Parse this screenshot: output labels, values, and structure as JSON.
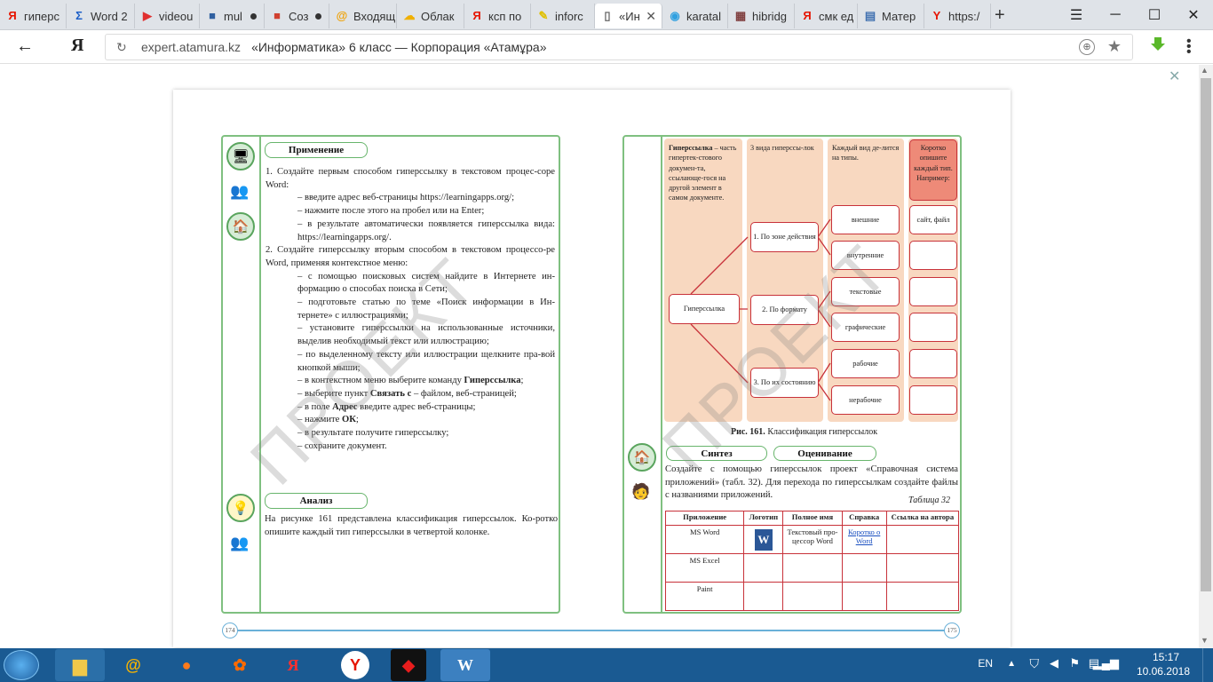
{
  "tabs": [
    {
      "label": "гиперс",
      "icon": "yandex-icon",
      "icon_color": "#e61400"
    },
    {
      "label": "Word 2",
      "icon": "sigma-icon",
      "icon_color": "#1e60c8"
    },
    {
      "label": "videou",
      "icon": "play-icon",
      "icon_color": "#e03030"
    },
    {
      "label": "mul",
      "icon": "cube-icon",
      "icon_color": "#3060a0",
      "modified": true
    },
    {
      "label": "Соз",
      "icon": "briefcase-icon",
      "icon_color": "#d04030",
      "modified": true
    },
    {
      "label": "Входящ",
      "icon": "mail-icon",
      "icon_color": "#f0a000"
    },
    {
      "label": "Облак",
      "icon": "cloud-icon",
      "icon_color": "#f0b000"
    },
    {
      "label": "ксп по",
      "icon": "yandex-icon",
      "icon_color": "#e61400"
    },
    {
      "label": "inforc",
      "icon": "pencil-icon",
      "icon_color": "#e0c000"
    },
    {
      "label": "«Ин",
      "icon": "document-icon",
      "icon_color": "#666666",
      "active": true
    },
    {
      "label": "karatal",
      "icon": "circle-icon",
      "icon_color": "#30a0e0"
    },
    {
      "label": "hibridg",
      "icon": "bridge-icon",
      "icon_color": "#804040"
    },
    {
      "label": "смк ед",
      "icon": "yandex-icon",
      "icon_color": "#e61400"
    },
    {
      "label": "Матер",
      "icon": "file-icon",
      "icon_color": "#4070b0"
    },
    {
      "label": "https:/",
      "icon": "yandex-y-icon",
      "icon_color": "#e61400"
    }
  ],
  "address": {
    "domain": "expert.atamura.kz",
    "title": "«Информатика» 6 класс — Корпорация «Атамұра»"
  },
  "left_page": {
    "application_title": "Применение",
    "application_text": [
      {
        "text": "1. Создайте первым способом гиперссылку в текстовом процес-соре Word:",
        "indent": false
      },
      {
        "text": "– введите адрес веб-страницы https://learningapps.org/;",
        "indent": true
      },
      {
        "text": "– нажмите после этого на пробел или на Enter;",
        "indent": true
      },
      {
        "text": "– в результате автоматически появляется гиперссылка вида: https://learningapps.org/.",
        "indent": true
      },
      {
        "text": "2. Создайте гиперссылку вторым способом в текстовом процессо-ре Word, применяя контекстное меню:",
        "indent": false
      },
      {
        "text": "– с помощью поисковых систем найдите в Интернете ин-формацию о способах поиска в Сети;",
        "indent": true
      },
      {
        "text": "– подготовьте статью по теме «Поиск информации в Ин-тернете» с иллюстрациями;",
        "indent": true
      },
      {
        "text": "– установите гиперссылки на использованные источники, выделив необходимый текст или иллюстрацию;",
        "indent": true
      },
      {
        "text": "– по выделенному тексту или иллюстрации щелкните пра-вой кнопкой мыши;",
        "indent": true
      },
      {
        "text": "– в контекстном меню выберите команду Гиперссылка;",
        "indent": true
      },
      {
        "text": "– выберите пункт Связать с – файлом, веб-страницей;",
        "indent": true
      },
      {
        "text": "– в поле Адрес введите адрес веб-страницы;",
        "indent": true
      },
      {
        "text": "– нажмите ОК;",
        "indent": true
      },
      {
        "text": "– в результате получите гиперссылку;",
        "indent": true
      },
      {
        "text": "– сохраните документ.",
        "indent": true
      }
    ],
    "analysis_title": "Анализ",
    "analysis_text": "На рисунке 161 представлена классификация гиперссылок. Ко-ротко опишите каждый тип гиперссылки в четвертой колонке.",
    "page_number": "174",
    "watermark": "ПРОЕКТ"
  },
  "right_page": {
    "diagram": {
      "col1_bold": "Гиперссылка",
      "col1_text": "– часть гипертек-стового докумен-та, ссылающе-гося на другой элемент в самом документе.",
      "col2_header": "3 вида гиперссы-лок",
      "col3_header": "Каждый вид де-лится на типы.",
      "col4_header": "Коротко опишите каждый тип. Например:",
      "root": "Гиперссылка",
      "kinds": [
        "1. По зоне действия",
        "2. По формату",
        "3. По их состоянию"
      ],
      "types": [
        "внешние",
        "внутренние",
        "текстовые",
        "графические",
        "рабочие",
        "нерабочие"
      ],
      "descriptions": [
        "сайт, файл",
        "",
        "",
        "",
        "",
        ""
      ]
    },
    "caption_bold": "Рис. 161.",
    "caption_text": "Классификация гиперссылок",
    "synthesis_title": "Синтез",
    "evaluation_title": "Оценивание",
    "synthesis_text": "Создайте с помощью гиперссылок проект «Справочная система приложений» (табл. 32). Для перехода по гиперссылкам создайте файлы с названиями приложений.",
    "table_label": "Таблица 32",
    "table_headers": [
      "Приложение",
      "Логотип",
      "Полное имя",
      "Справка",
      "Ссылка на автора"
    ],
    "table_rows": [
      [
        "MS Word",
        "",
        "Текстовый про-цессор Word",
        "Коротко о Word",
        ""
      ],
      [
        "MS Excel",
        "",
        "",
        "",
        ""
      ],
      [
        "Paint",
        "",
        "",
        "",
        ""
      ]
    ],
    "page_number": "175",
    "watermark": "ПРОЕКТ"
  },
  "taskbar": {
    "language": "EN",
    "time": "15:17",
    "date": "10.06.2018"
  },
  "colors": {
    "frame_green": "#7fc080",
    "diagram_red": "#c8323a",
    "column_peach": "#f8d8c0",
    "taskbar_blue": "#1a5a92"
  }
}
